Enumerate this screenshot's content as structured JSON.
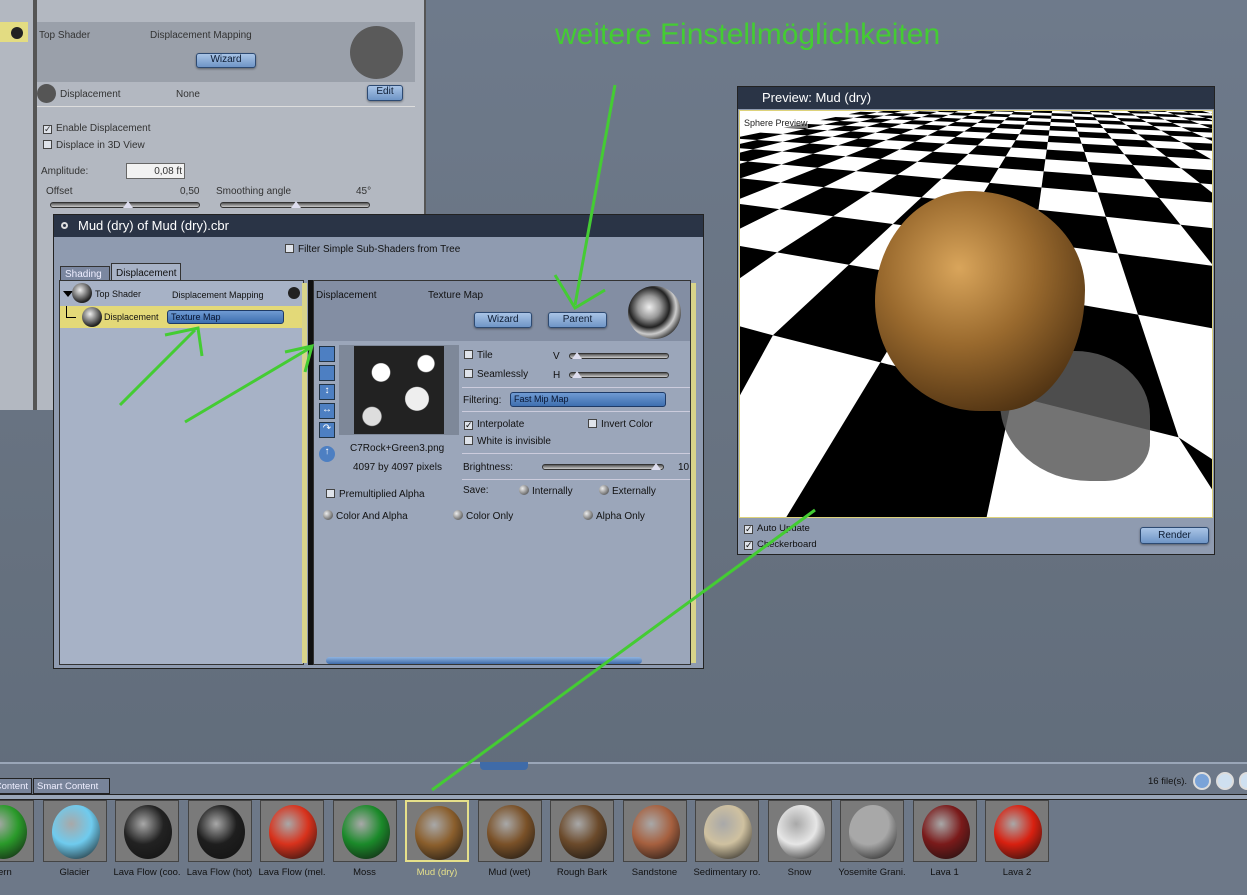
{
  "annotation": {
    "text": "weitere Einstellmöglichkeiten",
    "color": "#44cc33"
  },
  "bg_panel": {
    "top_shader": "Top Shader",
    "mapping": "Displacement Mapping",
    "wizard": "Wizard",
    "displacement": "Displacement",
    "disp_value": "None",
    "edit": "Edit",
    "enable_displacement": "Enable Displacement",
    "displace_3d": "Displace in 3D View",
    "amplitude_label": "Amplitude:",
    "amplitude_value": "0,08 ft",
    "offset_label": "Offset",
    "offset_value": "0,50",
    "smoothing_label": "Smoothing angle",
    "smoothing_value": "45°",
    "offset_fraction": 0.5,
    "smoothing_fraction": 0.5
  },
  "dialog": {
    "title": "Mud (dry) of Mud (dry).cbr",
    "filter": "Filter Simple Sub-Shaders from Tree",
    "tabs": [
      "Shading",
      "Displacement"
    ],
    "tree": {
      "top_shader": "Top Shader",
      "top_mapping": "Displacement Mapping",
      "child": "Displacement",
      "child_value": "Texture Map"
    },
    "editor": {
      "name": "Displacement",
      "type": "Texture Map",
      "wizard": "Wizard",
      "parent": "Parent",
      "file": "C7Rock+Green3.png",
      "size": "4097 by 4097 pixels",
      "tile": "Tile",
      "seamlessly": "Seamlessly",
      "v": "V",
      "h": "H",
      "filtering_label": "Filtering:",
      "filtering_value": "Fast Mip Map",
      "interpolate": "Interpolate",
      "invert_color": "Invert Color",
      "white_invisible": "White is invisible",
      "brightness_label": "Brightness:",
      "brightness_value": "10",
      "save_label": "Save:",
      "internally": "Internally",
      "externally": "Externally",
      "premultiplied": "Premultiplied Alpha",
      "color_alpha": "Color And Alpha",
      "color_only": "Color Only",
      "alpha_only": "Alpha Only"
    }
  },
  "preview": {
    "title": "Preview: Mud (dry)",
    "label": "Sphere Preview",
    "auto_update": "Auto Update",
    "checkerboard": "Checkerboard",
    "render": "Render"
  },
  "shelf": {
    "tabs": [
      "Content",
      "Smart Content"
    ],
    "file_count": "16 file(s).",
    "items": [
      {
        "label": "Fern",
        "color": "#2a9a2a"
      },
      {
        "label": "Glacier",
        "color": "#6fcbee"
      },
      {
        "label": "Lava Flow (coo.",
        "color": "#222"
      },
      {
        "label": "Lava Flow (hot)",
        "color": "#1e1e1e"
      },
      {
        "label": "Lava Flow (mel.",
        "color": "#d8321c"
      },
      {
        "label": "Moss",
        "color": "#1b8a2a"
      },
      {
        "label": "Mud (dry)",
        "color": "#8a5e2c",
        "selected": true
      },
      {
        "label": "Mud (wet)",
        "color": "#7a5128"
      },
      {
        "label": "Rough Bark",
        "color": "#6b4a2b"
      },
      {
        "label": "Sandstone",
        "color": "#a6603f"
      },
      {
        "label": "Sedimentary ro.",
        "color": "#cfc1a0"
      },
      {
        "label": "Snow",
        "color": "#e6e6e6"
      },
      {
        "label": "Yosemite Grani.",
        "color": "#a8a8a8"
      },
      {
        "label": "Lava 1",
        "color": "#7a1a1a"
      },
      {
        "label": "Lava 2",
        "color": "#d82010"
      }
    ]
  }
}
